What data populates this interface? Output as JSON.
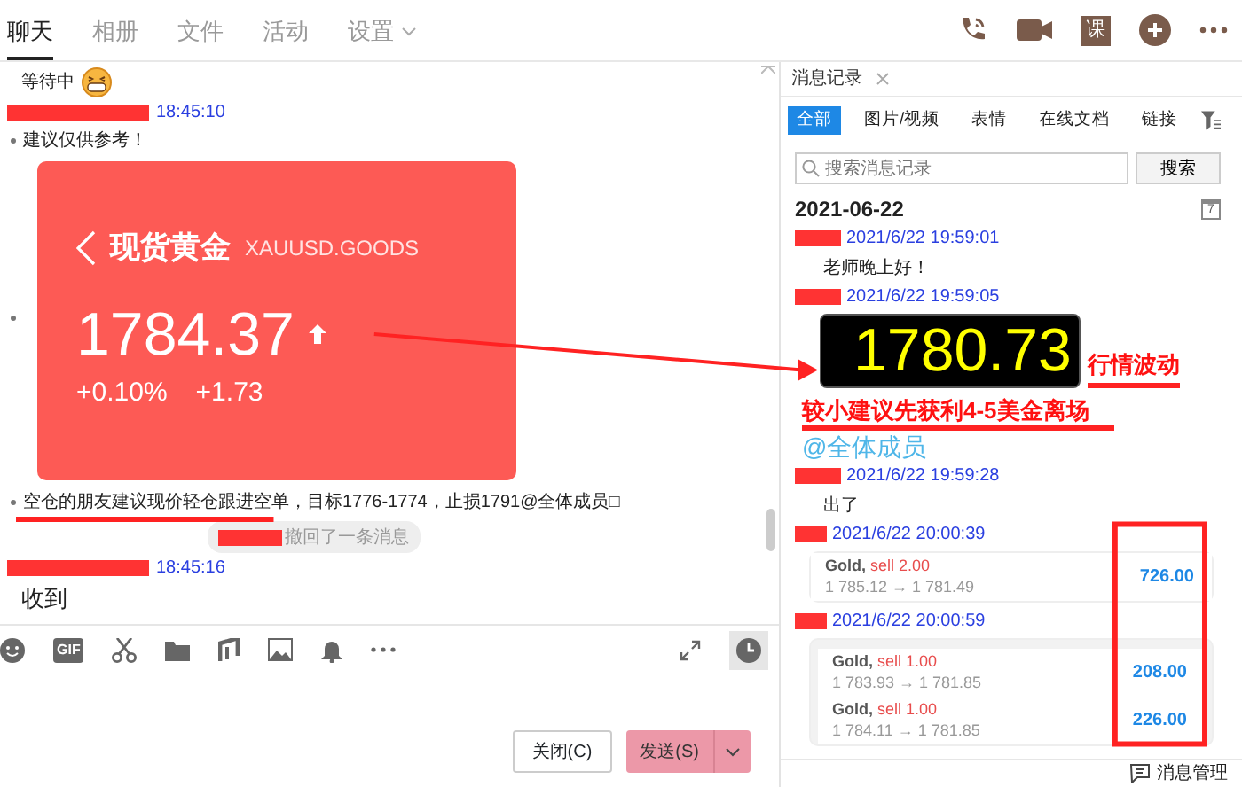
{
  "tabs": [
    {
      "label": "聊天",
      "selected": true,
      "dropdown": false
    },
    {
      "label": "相册",
      "selected": false,
      "dropdown": false
    },
    {
      "label": "文件",
      "selected": false,
      "dropdown": false
    },
    {
      "label": "活动",
      "selected": false,
      "dropdown": false
    },
    {
      "label": "设置",
      "selected": false,
      "dropdown": true
    }
  ],
  "header_icons": {
    "lesson_label": "课"
  },
  "chat": {
    "items": [
      {
        "kind": "status",
        "text": "等待中"
      },
      {
        "kind": "sender",
        "time": "18:45:10"
      },
      {
        "kind": "text",
        "bullet": true,
        "text": "建议仅供参考！"
      },
      {
        "kind": "price_card",
        "bullet": true,
        "name": "现货黄金",
        "symbol": "XAUUSD.GOODS",
        "price": "1784.37",
        "change_pct": "+0.10%",
        "change": "+1.73"
      },
      {
        "kind": "text",
        "bullet": true,
        "text": "空仓的朋友建议现价轻仓跟进空单，目标1776-1774，止损1791@全体成员□"
      },
      {
        "kind": "recall",
        "text": "撤回了一条消息"
      },
      {
        "kind": "sender",
        "time": "18:45:16"
      },
      {
        "kind": "text",
        "bullet": false,
        "text": "收到"
      }
    ]
  },
  "toolbar": {
    "gif_label": "GIF"
  },
  "buttons": [
    {
      "label": "关闭(C)",
      "kind": "close"
    },
    {
      "label": "发送(S)",
      "kind": "send"
    }
  ],
  "history": {
    "tab": "消息记录",
    "filters": [
      {
        "label": "全部",
        "selected": true
      },
      {
        "label": "图片/视频",
        "selected": false
      },
      {
        "label": "表情",
        "selected": false
      },
      {
        "label": "在线文档",
        "selected": false
      },
      {
        "label": "链接",
        "selected": false
      }
    ],
    "search_placeholder": "搜索消息记录",
    "search_button": "搜索",
    "date": "2021-06-22",
    "calendar_day": "7",
    "entries": [
      {
        "time": "2021/6/22 19:59:01",
        "content": [
          {
            "kind": "text",
            "text": "老师晚上好！"
          }
        ]
      },
      {
        "time": "2021/6/22 19:59:05",
        "content": [
          {
            "kind": "ticker",
            "text": "1780.73",
            "tag": "行情波动"
          },
          {
            "kind": "alert",
            "text": "较小建议先获利4-5美金离场"
          },
          {
            "kind": "mention",
            "text": "@全体成员"
          }
        ]
      },
      {
        "time": "2021/6/22 19:59:28",
        "content": [
          {
            "kind": "text",
            "text": "出了"
          }
        ]
      },
      {
        "time": "2021/6/22 20:00:39",
        "content": [
          {
            "kind": "trades",
            "trades": [
              {
                "symbol": "Gold,",
                "side": "sell 2.00",
                "prices": "1 785.12 → 1 781.49",
                "profit": "726.00"
              }
            ]
          }
        ]
      },
      {
        "time": "2021/6/22 20:00:59",
        "content": [
          {
            "kind": "trades",
            "trades": [
              {
                "symbol": "Gold,",
                "side": "sell 1.00",
                "prices": "1 783.93 → 1 781.85",
                "profit": "208.00"
              },
              {
                "symbol": "Gold,",
                "side": "sell 1.00",
                "prices": "1 784.11 → 1 781.85",
                "profit": "226.00"
              }
            ]
          }
        ]
      }
    ],
    "footer": "消息管理"
  }
}
